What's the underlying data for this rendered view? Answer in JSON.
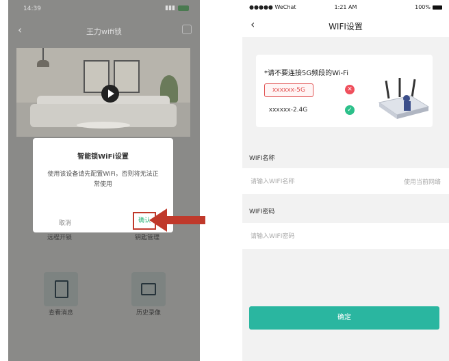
{
  "left_phone": {
    "status_time": "14:39",
    "nav_title": "王力wifi锁",
    "dialog": {
      "title": "智能锁WiFi设置",
      "message": "使用该设备请先配置WiFi，否则将无法正常使用",
      "cancel_label": "取消",
      "confirm_label": "确认"
    },
    "functions": {
      "remote_unlock": "远程开锁",
      "key_management": "钥匙管理",
      "view_messages": "查看消息",
      "history_video": "历史录像"
    }
  },
  "right_phone": {
    "status_left": "●●●●● WeChat",
    "status_time": "1:21 AM",
    "status_battery": "100%",
    "nav_title": "WIFI设置",
    "tip_text": "*请不要连接5G频段的Wi-Fi",
    "tag_5g": "xxxxxx-5G",
    "tag_24g": "xxxxxx-2.4G",
    "wifi_name_label": "WIFI名称",
    "wifi_name_placeholder": "请输入WIFI名称",
    "use_current_network": "使用当前网络",
    "wifi_password_label": "WIFI密码",
    "wifi_password_placeholder": "请输入WIFI密码",
    "confirm_button": "确定"
  },
  "colors": {
    "accent_teal": "#2ab6a0",
    "error_red": "#ef4f5c",
    "success_green": "#2cc08a",
    "highlight_arrow": "#c0392b"
  }
}
